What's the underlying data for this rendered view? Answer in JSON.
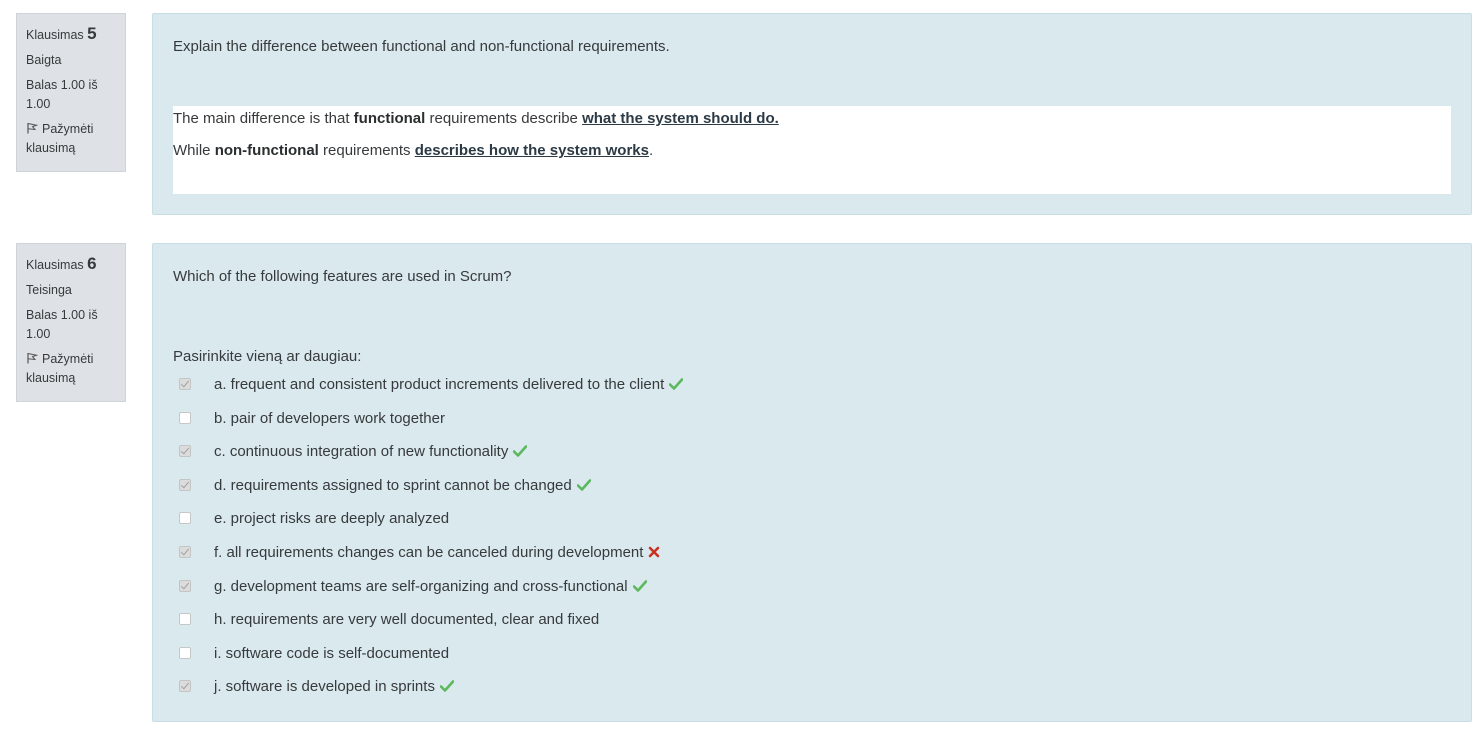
{
  "q5": {
    "label": "Klausimas",
    "number": "5",
    "state": "Baigta",
    "grade": "Balas 1.00 iš 1.00",
    "flag_label": "Pažymėti klausimą",
    "question_text": "Explain the difference between functional and non-functional requirements.",
    "answer": {
      "line1_prefix": "The main difference is that ",
      "line1_bold": "functional",
      "line1_mid": " requirements describe ",
      "line1_link": "what the system should do.",
      "line2_prefix": "While ",
      "line2_bold": "non-functional",
      "line2_mid": " requirements ",
      "line2_link": "describes how the system works",
      "line2_suffix": "."
    }
  },
  "q6": {
    "label": "Klausimas",
    "number": "6",
    "state": "Teisinga",
    "grade": "Balas 1.00 iš 1.00",
    "flag_label": "Pažymėti klausimą",
    "question_text": "Which of the following features are used in Scrum?",
    "prompt": "Pasirinkite vieną ar daugiau:",
    "options": [
      {
        "label": "a. frequent and consistent product increments delivered to the client",
        "checked": true,
        "mark": "correct"
      },
      {
        "label": "b. pair of developers work together",
        "checked": false,
        "mark": ""
      },
      {
        "label": "c. continuous integration of new functionality",
        "checked": true,
        "mark": "correct"
      },
      {
        "label": "d. requirements assigned to sprint cannot be changed",
        "checked": true,
        "mark": "correct"
      },
      {
        "label": "e. project risks are deeply analyzed",
        "checked": false,
        "mark": ""
      },
      {
        "label": "f. all requirements changes can be canceled during development",
        "checked": true,
        "mark": "incorrect"
      },
      {
        "label": "g. development teams are self-organizing and cross-functional",
        "checked": true,
        "mark": "correct"
      },
      {
        "label": "h. requirements are very well documented, clear and fixed",
        "checked": false,
        "mark": ""
      },
      {
        "label": "i. software code is self-documented",
        "checked": false,
        "mark": ""
      },
      {
        "label": "j. software is developed in sprints",
        "checked": true,
        "mark": "correct"
      }
    ]
  },
  "colors": {
    "correct": "#5cb85c",
    "incorrect": "#ca3120",
    "content_bg": "#dae9ee",
    "info_bg": "#dee2e6"
  },
  "icons": {
    "flag": "flag-icon",
    "correct": "check-icon",
    "incorrect": "cross-icon"
  }
}
